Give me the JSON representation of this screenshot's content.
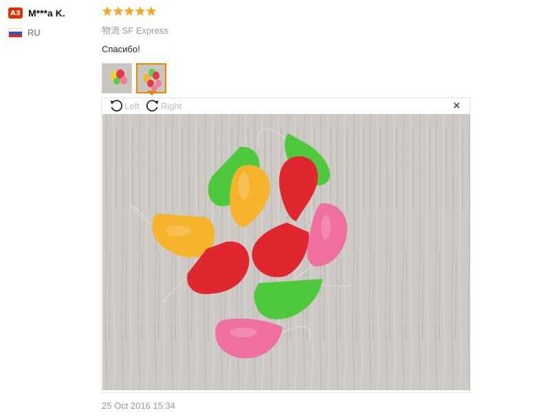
{
  "user": {
    "level_badge": "A3",
    "name": "M***a K.",
    "country_code": "RU",
    "flag_icon": "russia-flag-icon"
  },
  "review": {
    "rating_stars": 5,
    "logistics": "物流 SF Express",
    "feedback_text": "Спасибо!",
    "thumbnails": [
      "thumbnail-1",
      "thumbnail-2"
    ],
    "active_thumbnail": 2,
    "timestamp": "25 Oct 2016 15:34"
  },
  "viewer": {
    "rotate_left_label": "Left",
    "rotate_right_label": "Right",
    "close_label": "×"
  },
  "colors": {
    "accent": "#f08200",
    "star": "#f5a623",
    "badge": "#e62e04"
  }
}
